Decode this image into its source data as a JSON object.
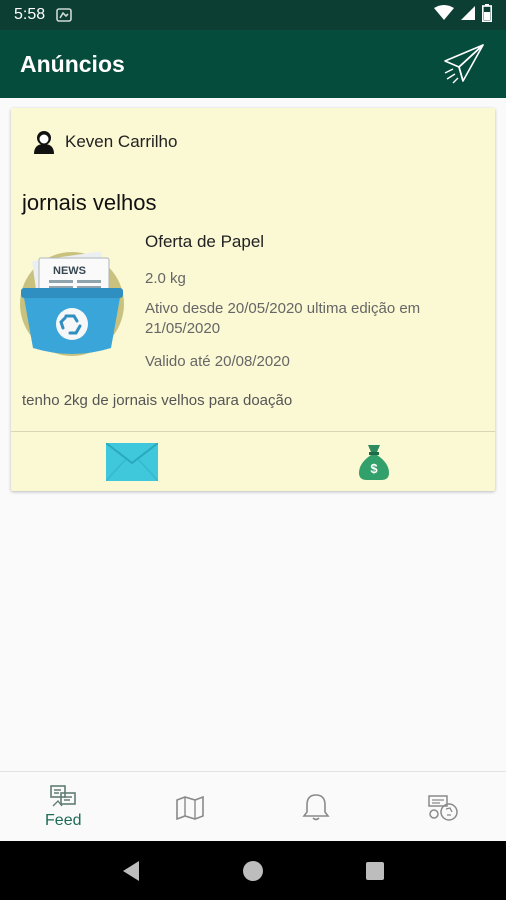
{
  "status_bar": {
    "time": "5:58"
  },
  "app_bar": {
    "title": "Anúncios"
  },
  "ad": {
    "author": "Keven Carrilho",
    "title": "jornais velhos",
    "category": "Oferta de Papel",
    "weight": "2.0 kg",
    "dates": "Ativo desde 20/05/2020 ultima edição em 21/05/2020",
    "valid_until": "Valido até 20/08/2020",
    "description": "tenho 2kg de jornais velhos para doação",
    "image_label": "NEWS"
  },
  "bottom_nav": {
    "feed_label": "Feed"
  },
  "colors": {
    "app_bar": "#064c3d",
    "card": "#fbf8d4",
    "accent": "#1d6b57"
  }
}
